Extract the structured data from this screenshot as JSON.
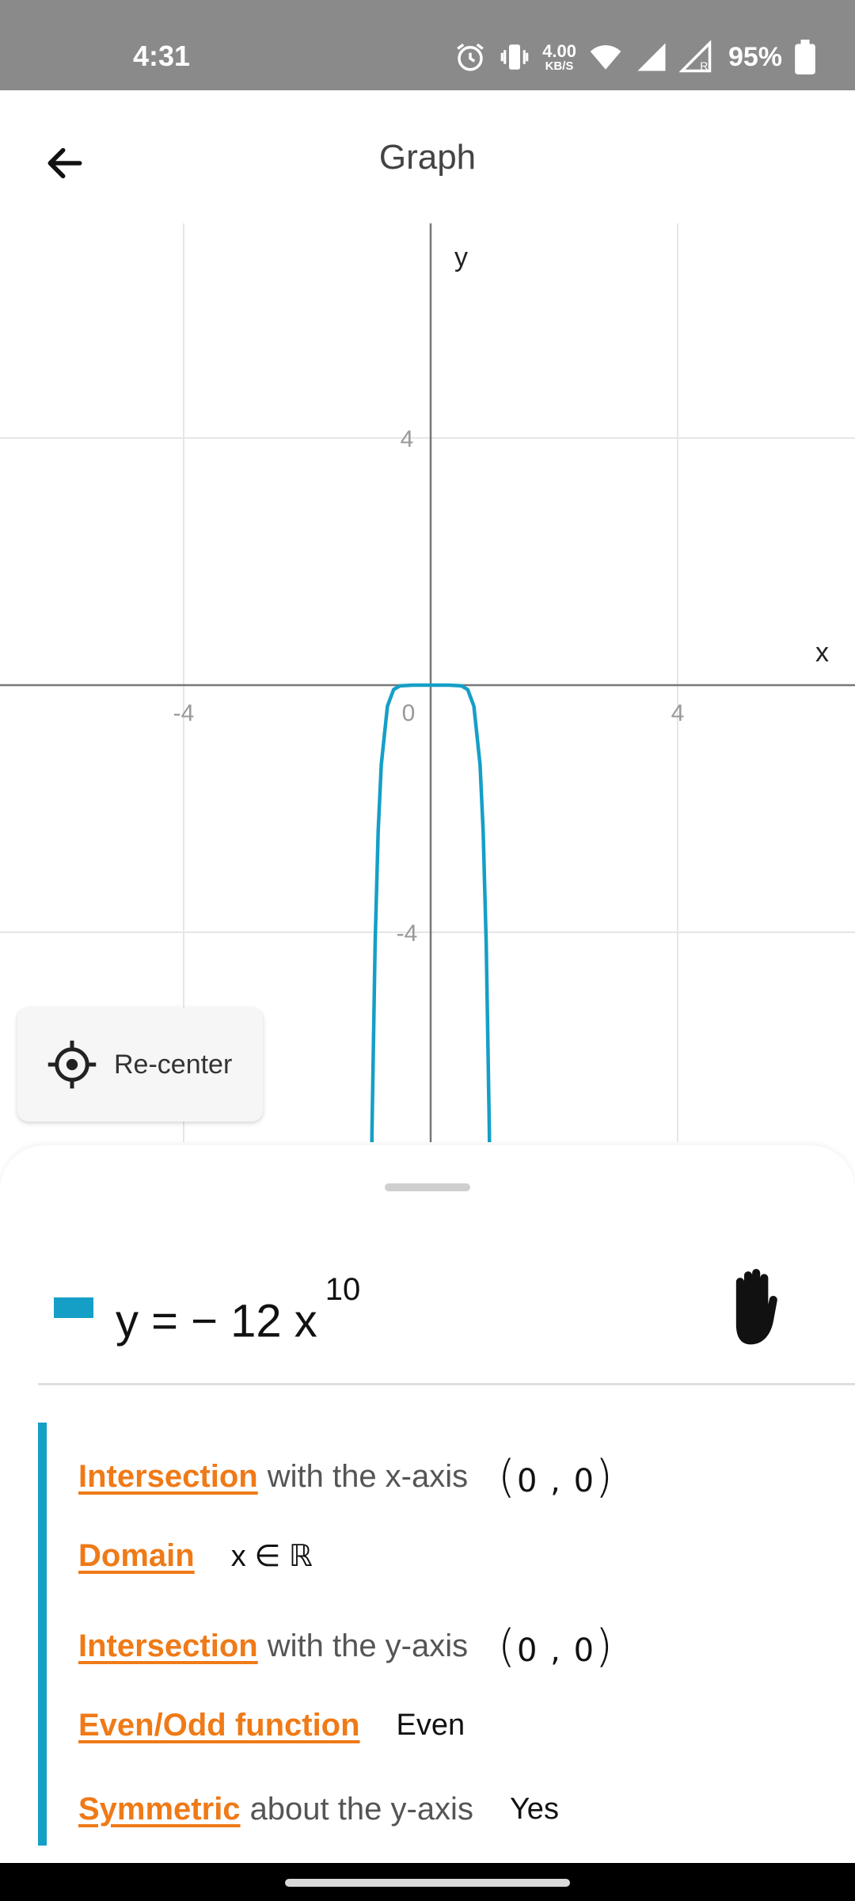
{
  "status_bar": {
    "time": "4:31",
    "speed_value": "4.00",
    "speed_unit": "KB/S",
    "battery": "95%",
    "icons": [
      "alarm-icon",
      "vibrate-icon",
      "wifi-icon",
      "signal-icon",
      "signal-roaming-icon",
      "battery-icon"
    ]
  },
  "app_bar": {
    "title": "Graph",
    "back_icon": "arrow-left-icon"
  },
  "graph": {
    "x_axis_label": "x",
    "y_axis_label": "y",
    "origin_label": "0",
    "x_ticks": [
      "-4",
      "4"
    ],
    "y_ticks": [
      "4",
      "-4"
    ],
    "curve_color": "#159fc7",
    "recenter_label": "Re-center",
    "recenter_icon": "crosshair-icon"
  },
  "chart_data": {
    "type": "line",
    "title": "",
    "xlabel": "x",
    "ylabel": "y",
    "xlim": [
      -7,
      7
    ],
    "ylim": [
      -7.8,
      7.6
    ],
    "grid": true,
    "series": [
      {
        "name": "y = −12x^10",
        "x": [
          -1.05,
          -1.0,
          -0.95,
          -0.9,
          -0.85,
          -0.8,
          -0.7,
          -0.6,
          -0.5,
          -0.3,
          0,
          0.3,
          0.5,
          0.6,
          0.7,
          0.8,
          0.85,
          0.9,
          0.95,
          1.0,
          1.05
        ],
        "y": [
          -19.5,
          -12,
          -7.2,
          -4.2,
          -2.36,
          -1.29,
          -0.34,
          -0.072,
          -0.012,
          -0.0001,
          0,
          -0.0001,
          -0.012,
          -0.072,
          -0.34,
          -1.29,
          -2.36,
          -4.2,
          -7.2,
          -12,
          -19.5
        ]
      }
    ]
  },
  "function": {
    "equation_main": "y = − 12 x",
    "equation_exp": "10",
    "color": "#159fc7",
    "hand_icon": "hand-icon"
  },
  "properties": [
    {
      "link": "Intersection",
      "rest": "with the x-axis",
      "point": "0 , 0"
    },
    {
      "link": "Domain",
      "value": "x ∈ ℝ"
    },
    {
      "link": "Intersection",
      "rest": "with the y-axis",
      "point": "0 , 0"
    },
    {
      "link": "Even/Odd function",
      "value": "Even"
    },
    {
      "link": "Symmetric",
      "rest": "about the y-axis",
      "value": "Yes"
    }
  ]
}
